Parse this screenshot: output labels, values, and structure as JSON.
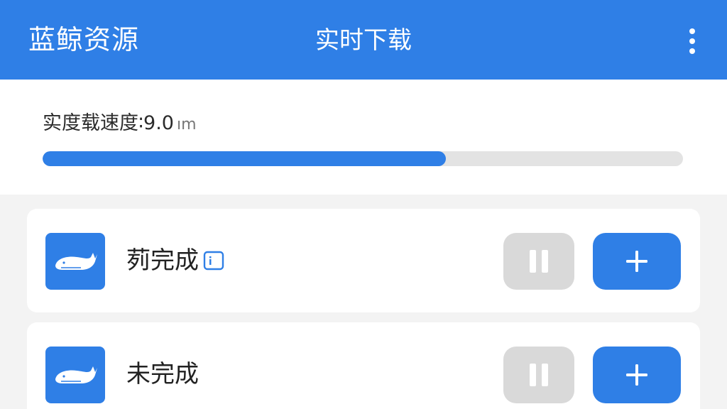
{
  "appbar": {
    "app_title": "蓝鲸资源",
    "page_title": "实时下载",
    "menu_icon": "more-vertical-icon"
  },
  "speed": {
    "label": "实度载速度",
    "separator": "∶",
    "value": "9.0",
    "unit": "ım",
    "progress_fraction": 0.63
  },
  "downloads": [
    {
      "title": "茢完成",
      "thumb_icon": "whale-icon",
      "badge_icon": "info-box-icon",
      "pause_icon": "pause-icon",
      "add_icon": "plus-icon"
    },
    {
      "title": "未完成",
      "thumb_icon": "whale-icon",
      "pause_icon": "pause-icon",
      "add_icon": "plus-icon"
    }
  ],
  "colors": {
    "accent": "#2f7fe6",
    "disabled": "#d9d9d9",
    "track": "#e3e3e3",
    "background": "#f3f3f3"
  }
}
